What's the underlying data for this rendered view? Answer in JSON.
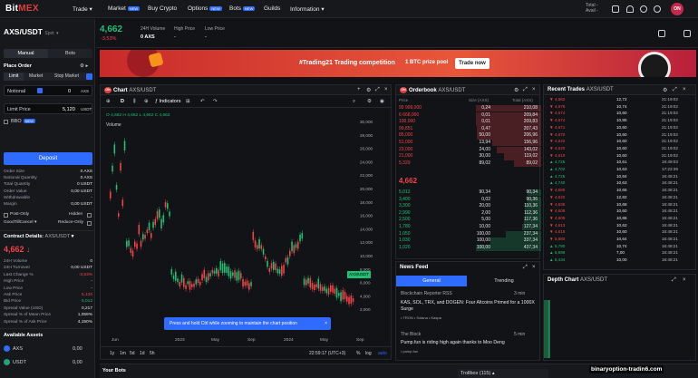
{
  "nav": {
    "logo_a": "Bit",
    "logo_b": "MEX",
    "items": [
      "Trade",
      "Market",
      "Buy Crypto",
      "Options",
      "Bots",
      "Guilds",
      "Information"
    ],
    "new_badge": "NEW",
    "total_label": "Total",
    "avail_label": "Avail",
    "total_value": "-",
    "avail_value": "-",
    "avatar": "ON"
  },
  "ticker": {
    "symbol": "AXS/USDT",
    "kind": "Spot",
    "price": "4,662",
    "change": "-3,53%",
    "volume_label": "24H Volume",
    "volume": "0 AXS",
    "high_label": "High Price",
    "high": "-",
    "low_label": "Low Price",
    "low": "-"
  },
  "order": {
    "manual": "Manual",
    "bots": "Bots",
    "place_order": "Place Order",
    "types": [
      "Limit",
      "Market",
      "Stop Market"
    ],
    "notional_label": "Notional",
    "notional_unit": "AXS",
    "limit_label": "Limit Price",
    "limit_value": "5,120",
    "limit_unit": "USDT",
    "bbo": "BBO",
    "deposit": "Deposit",
    "rows": [
      [
        "Order Size",
        "0 AXS"
      ],
      [
        "Notional Quantity",
        "0 AXS"
      ],
      [
        "Total Quantity",
        "0 USDT"
      ],
      [
        "Order Value",
        "0,00 USDT"
      ],
      [
        "Withdrawable",
        "-"
      ],
      [
        "Margin",
        "0,00 USDT"
      ]
    ],
    "post_only": "Post-Only",
    "hidden": "Hidden",
    "gtc": "GoodTillCancel",
    "reduce_only": "Reduce-Only"
  },
  "contract": {
    "title": "Contract Details:",
    "symbol": "AXS/USDT",
    "price": "4,662",
    "rows": [
      [
        "24H Volume",
        "0"
      ],
      [
        "24H Turnover",
        "0,00 USDT"
      ],
      [
        "Last Change %",
        "-3,53%"
      ],
      [
        "High Price",
        "-"
      ],
      [
        "Low Price",
        "-"
      ],
      [
        "Ask Price",
        "5,120"
      ],
      [
        "Bid Price",
        "5,012"
      ],
      [
        "Spread Value (USD)",
        "0,217"
      ],
      [
        "Spread % of Mean Price",
        "1,059%"
      ],
      [
        "Spread % of Ask Price",
        "4,150%"
      ]
    ]
  },
  "assets": {
    "title": "Available Assets",
    "items": [
      [
        "AXS",
        "0,00"
      ],
      [
        "USDT",
        "0,00"
      ]
    ]
  },
  "banner": {
    "text": "#Trading21 Trading competition",
    "prize": "1 BTC prize pool",
    "button": "Trade now"
  },
  "chart": {
    "title": "Chart",
    "symbol": "AXS/USDT",
    "indicators": "Indicators",
    "ohlc": "O 4,662  H 4,662  L 4,662  C 4,662",
    "volume": "Volume",
    "tag": "AXS/USDT",
    "tag_price": "4,662",
    "tooltip": "Press and hold Ctrl while zooming to maintain the chart position",
    "timeframes": [
      "1y",
      "1m",
      "5d",
      "1d",
      "5h"
    ],
    "time": "22:59:17 (UTC+3)",
    "pct": "%",
    "log": "log",
    "auto": "auto",
    "yticks": [
      "30,000",
      "28,000",
      "26,000",
      "24,000",
      "22,000",
      "20,000",
      "18,000",
      "16,000",
      "14,000",
      "12,000",
      "10,000",
      "8,000",
      "6,000",
      "4,000",
      "2,000"
    ],
    "xticks": [
      "Jun",
      "2023",
      "May",
      "Sep",
      "2024",
      "May",
      "Sep"
    ]
  },
  "orderbook": {
    "title": "Orderbook",
    "symbol": "AXS/USDT",
    "headers": [
      "Price",
      "Size (AXS)",
      "Total (AXS)"
    ],
    "asks": [
      [
        "99 999,000",
        "0,24",
        "210,08"
      ],
      [
        "6 668,000",
        "0,01",
        "209,84"
      ],
      [
        "100,000",
        "0,01",
        "209,83"
      ],
      [
        "99,851",
        "0,47",
        "207,43"
      ],
      [
        "85,000",
        "50,00",
        "206,96"
      ],
      [
        "51,000",
        "13,94",
        "156,96"
      ],
      [
        "23,000",
        "24,00",
        "143,02"
      ],
      [
        "21,000",
        "30,00",
        "119,02"
      ],
      [
        "5,329",
        "89,02",
        "89,02"
      ]
    ],
    "mid": "4,662",
    "bids": [
      [
        "5,012",
        "90,34",
        "90,34"
      ],
      [
        "3,400",
        "0,02",
        "90,36"
      ],
      [
        "3,300",
        "20,00",
        "110,36"
      ],
      [
        "2,990",
        "2,00",
        "112,36"
      ],
      [
        "2,500",
        "5,00",
        "117,36"
      ],
      [
        "1,780",
        "10,00",
        "127,34"
      ],
      [
        "1,050",
        "100,00",
        "237,34"
      ],
      [
        "1,030",
        "100,00",
        "337,34"
      ],
      [
        "1,020",
        "100,00",
        "437,34"
      ]
    ]
  },
  "trades": {
    "title": "Recent Trades",
    "symbol": "AXS/USDT",
    "rows": [
      [
        "4,662",
        "12,72",
        "21:19:02"
      ],
      [
        "4,675",
        "10,74",
        "21:19:02"
      ],
      [
        "4,674",
        "10,60",
        "21:19:02"
      ],
      [
        "4,674",
        "10,85",
        "21:19:02"
      ],
      [
        "4,671",
        "10,60",
        "21:19:02"
      ],
      [
        "4,670",
        "10,60",
        "21:19:02"
      ],
      [
        "4,642",
        "10,60",
        "21:19:02"
      ],
      [
        "4,620",
        "10,60",
        "21:19:02"
      ],
      [
        "4,619",
        "10,60",
        "21:19:02"
      ],
      [
        "4,725",
        "10,61",
        "19:49:03"
      ],
      [
        "4,702",
        "10,63",
        "17:22:39"
      ],
      [
        "4,725",
        "10,84",
        "16:48:21"
      ],
      [
        "4,740",
        "10,63",
        "16:48:21"
      ],
      [
        "4,680",
        "10,65",
        "16:48:21"
      ],
      [
        "4,620",
        "12,82",
        "16:48:21"
      ],
      [
        "4,635",
        "10,68",
        "16:48:21"
      ],
      [
        "4,608",
        "10,60",
        "16:48:21"
      ],
      [
        "4,609",
        "10,86",
        "16:48:21"
      ],
      [
        "4,613",
        "10,62",
        "16:48:21"
      ],
      [
        "4,615",
        "10,60",
        "16:48:21"
      ],
      [
        "5,880",
        "10,64",
        "16:48:21"
      ],
      [
        "5,790",
        "10,74",
        "16:48:21"
      ],
      [
        "5,896",
        "7,00",
        "16:48:21"
      ],
      [
        "5,434",
        "10,00",
        "16:48:21"
      ]
    ],
    "dirs": [
      "d",
      "d",
      "d",
      "d",
      "d",
      "d",
      "d",
      "d",
      "d",
      "u",
      "u",
      "u",
      "u",
      "d",
      "d",
      "d",
      "d",
      "d",
      "d",
      "d",
      "d",
      "u",
      "u",
      "u"
    ]
  },
  "news": {
    "title": "News Feed",
    "tabs": [
      "General",
      "Trending"
    ],
    "items": [
      {
        "source": "Blockchain Reporter RSS",
        "time": "3 min",
        "headline": "KAS, SOL, TRX, and DOGEN: Four Altcoins Primed for a 1000X Surge",
        "tags": "• TRON  • Solana  • Kaspa"
      },
      {
        "source": "The Block",
        "time": "5 min",
        "headline": "Pump.fun is riding high again thanks to Moo Deng",
        "tags": "• pump.fun"
      }
    ]
  },
  "depth": {
    "title": "Depth Chart",
    "symbol": "AXS/USDT"
  },
  "bottom": {
    "your_bots": "Your Bots",
    "trollbox": "Trollbox (115)",
    "watermark": "binaryoption-tradin6.com"
  }
}
